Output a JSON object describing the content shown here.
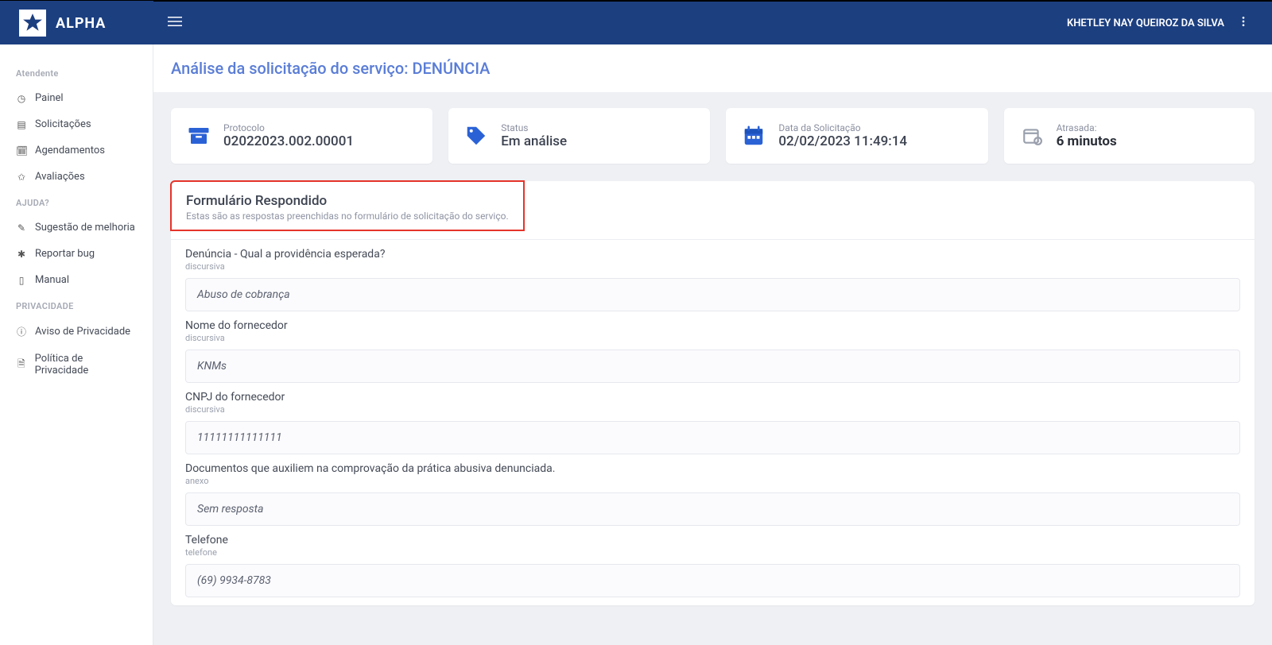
{
  "header": {
    "brand": "ALPHA",
    "user_name": "KHETLEY NAY QUEIROZ DA SILVA"
  },
  "sidebar": {
    "sections": [
      {
        "title": "Atendente",
        "items": [
          {
            "icon": "dashboard-icon",
            "glyph": "◷",
            "label": "Painel"
          },
          {
            "icon": "ticket-icon",
            "glyph": "▤",
            "label": "Solicitações"
          },
          {
            "icon": "calendar-icon",
            "glyph": "🗓",
            "label": "Agendamentos"
          },
          {
            "icon": "star-icon",
            "glyph": "✩",
            "label": "Avaliações"
          }
        ]
      },
      {
        "title": "AJUDA?",
        "items": [
          {
            "icon": "edit-icon",
            "glyph": "✎",
            "label": "Sugestão de melhoria"
          },
          {
            "icon": "bug-icon",
            "glyph": "✱",
            "label": "Reportar bug"
          },
          {
            "icon": "book-icon",
            "glyph": "▯",
            "label": "Manual"
          }
        ]
      },
      {
        "title": "PRIVACIDADE",
        "items": [
          {
            "icon": "info-icon",
            "glyph": "ⓘ",
            "label": "Aviso de Privacidade"
          },
          {
            "icon": "doc-icon",
            "glyph": "🗎",
            "label": "Política de Privacidade"
          }
        ]
      }
    ]
  },
  "page": {
    "title": "Análise da solicitação do serviço: DENÚNCIA"
  },
  "cards": [
    {
      "label": "Protocolo",
      "value": "02022023.002.00001"
    },
    {
      "label": "Status",
      "value": "Em análise"
    },
    {
      "label": "Data da Solicitação",
      "value": "02/02/2023 11:49:14"
    },
    {
      "label": "Atrasada:",
      "value": "6 minutos",
      "bold": true
    }
  ],
  "form_panel": {
    "heading": "Formulário Respondido",
    "subheading": "Estas são as respostas preenchidas no formulário de solicitação do serviço."
  },
  "fields": [
    {
      "label": "Denúncia - Qual a providência esperada?",
      "type": "discursiva",
      "value": "Abuso de cobrança"
    },
    {
      "label": "Nome do fornecedor",
      "type": "discursiva",
      "value": "KNMs"
    },
    {
      "label": "CNPJ do fornecedor",
      "type": "discursiva",
      "value": "11111111111111"
    },
    {
      "label": "Documentos que auxiliem na comprovação da prática abusiva denunciada.",
      "type": "anexo",
      "value": "Sem resposta"
    },
    {
      "label": "Telefone",
      "type": "telefone",
      "value": "(69) 9934-8783"
    }
  ]
}
